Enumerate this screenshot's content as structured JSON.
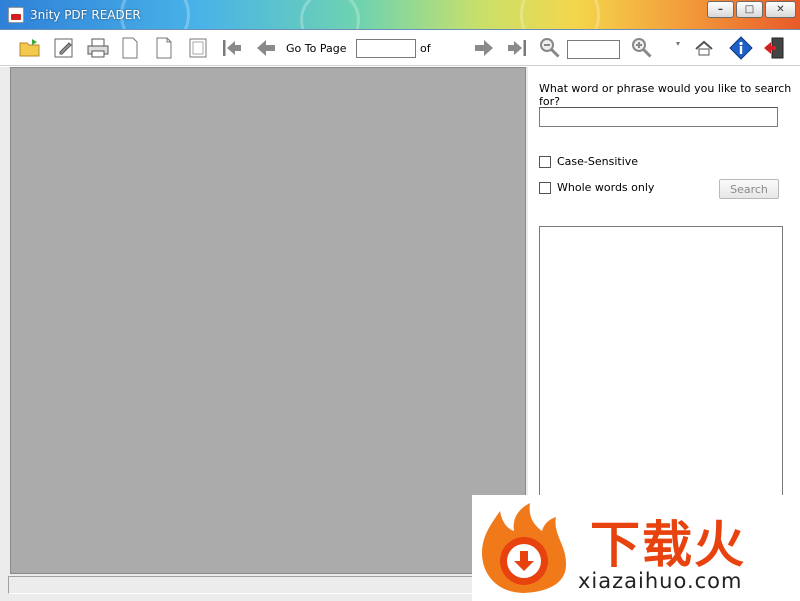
{
  "window": {
    "title": "3nity PDF READER",
    "minimize_glyph": "–",
    "maximize_glyph": "□",
    "close_glyph": "✕"
  },
  "toolbar": {
    "icons": [
      "open-folder-icon",
      "edit-document-icon",
      "print-icon",
      "single-page-icon",
      "facing-page-icon",
      "fit-page-icon",
      "first-page-icon",
      "previous-page-icon",
      "next-page-icon",
      "last-page-icon",
      "zoom-out-icon",
      "zoom-in-icon",
      "rotate-icon",
      "home-icon",
      "info-icon",
      "exit-icon"
    ],
    "goto_label": "Go To Page",
    "page_value": "",
    "of_label": "of",
    "zoom_value": ""
  },
  "search_panel": {
    "prompt": "What word or phrase would you like to search for?",
    "query_value": "",
    "case_sensitive_label": "Case-Sensitive",
    "whole_words_label": "Whole words only",
    "search_button_label": "Search"
  },
  "statusbar": {
    "text": ""
  },
  "watermark": {
    "brand_text": "下载火",
    "url": "xiazaihuo.com"
  },
  "colors": {
    "document_background": "#ababab",
    "watermark_accent": "#e8420e",
    "info_icon": "#1e5fc8",
    "arrow_icons": "#7a7a7a"
  }
}
